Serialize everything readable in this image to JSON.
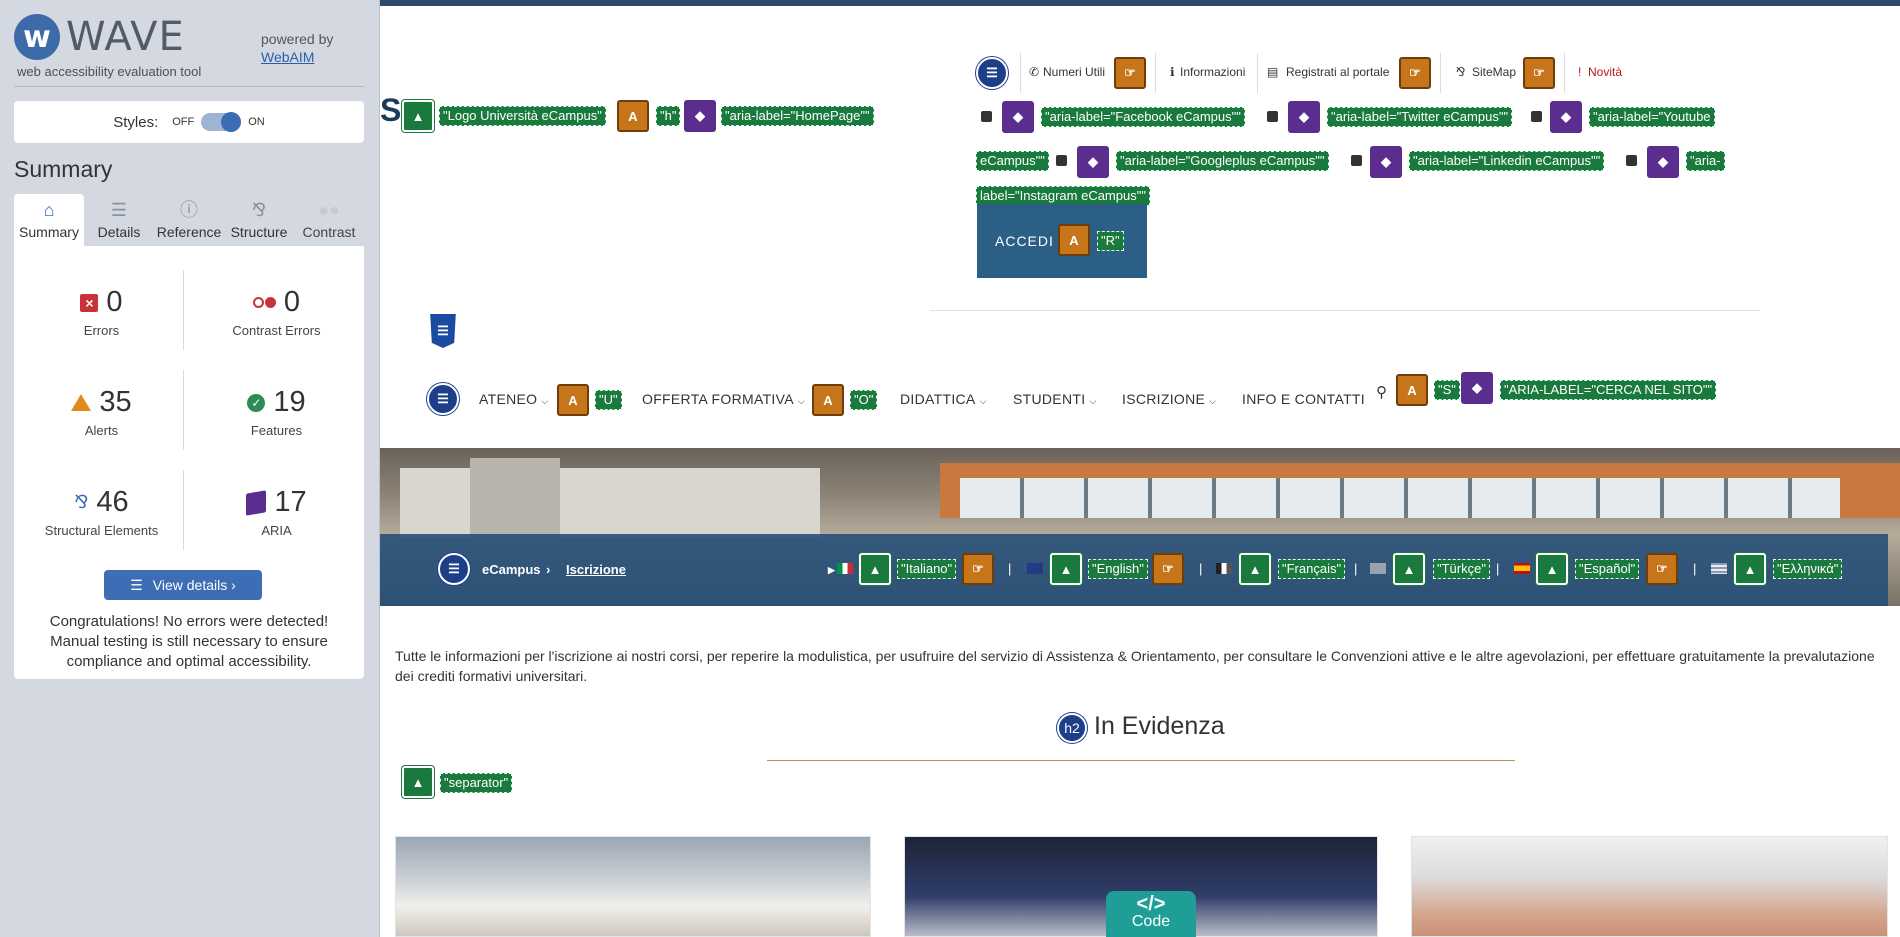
{
  "wave": {
    "logo_text": "WAVE",
    "tagline": "web accessibility evaluation tool",
    "powered_by": "powered by",
    "webaim": "WebAIM",
    "styles_label": "Styles:",
    "off_label": "OFF",
    "on_label": "ON",
    "summary_heading": "Summary",
    "tabs": [
      {
        "label": "Summary",
        "icon": "home-icon"
      },
      {
        "label": "Details",
        "icon": "list-icon"
      },
      {
        "label": "Reference",
        "icon": "info-icon"
      },
      {
        "label": "Structure",
        "icon": "hierarchy-icon"
      },
      {
        "label": "Contrast",
        "icon": "contrast-icon"
      }
    ],
    "stats": {
      "errors": {
        "value": "0",
        "label": "Errors"
      },
      "contrast_errors": {
        "value": "0",
        "label": "Contrast Errors"
      },
      "alerts": {
        "value": "35",
        "label": "Alerts"
      },
      "features": {
        "value": "19",
        "label": "Features"
      },
      "structural": {
        "value": "46",
        "label": "Structural Elements"
      },
      "aria": {
        "value": "17",
        "label": "ARIA"
      }
    },
    "view_details": "View details ›",
    "congrats": "Congratulations! No errors were detected! Manual testing is still necessary to ensure compliance and optimal accessibility."
  },
  "page": {
    "s_letter": "S",
    "header_tags": {
      "logo": "\"Logo Università eCampus\"",
      "h": "\"h\"",
      "homepage": "\"aria-label=\"HomePage\"\""
    },
    "util_links": [
      "Numeri Utili",
      "Informazioni",
      "Registrati al portale",
      "SiteMap",
      "Novità"
    ],
    "social_tags": {
      "facebook": "\"aria-label=\"Facebook eCampus\"\"",
      "twitter": "\"aria-label=\"Twitter eCampus\"\"",
      "youtube_a": "\"aria-label=\"Youtube",
      "youtube_b": "eCampus\"\"",
      "googleplus": "\"aria-label=\"Googleplus eCampus\"\"",
      "linkedin": "\"aria-label=\"Linkedin eCampus\"\"",
      "instagram_a": "\"aria-",
      "instagram_b": "label=\"Instagram eCampus\"\""
    },
    "accedi": "ACCEDI",
    "accedi_tag": "\"R\"",
    "nav": [
      "ATENEO",
      "OFFERTA FORMATIVA",
      "DIDATTICA",
      "STUDENTI",
      "ISCRIZIONE",
      "INFO E CONTATTI"
    ],
    "nav_tags": {
      "u": "\"U\"",
      "o": "\"O\"",
      "s": "\"S\"",
      "search": "\"ARIA-LABEL=\"CERCA NEL SITO\"\""
    },
    "breadcrumb": {
      "home": "eCampus",
      "sep": "›",
      "current": "Iscrizione"
    },
    "languages": [
      "\"Italiano\"",
      "\"English\"",
      "\"Français\"",
      "\"Türkçe\"",
      "\"Español\"",
      "\"Ελληνικά\""
    ],
    "lang_sep": "|",
    "intro": "Tutte le informazioni per l'iscrizione ai nostri corsi, per reperire la modulistica, per usufruire del servizio di Assistenza & Orientamento, per consultare le Convenzioni attive e le altre agevolazioni, per effettuare gratuitamente la prevalutazione dei crediti formativi universitari.",
    "h2_badge": "h2",
    "evidenza": "In Evidenza",
    "separator_tag": "\"separator\"",
    "code_badge": {
      "symbol": "</>",
      "label": "Code"
    }
  },
  "colors": {
    "wave_blue": "#3d6db5",
    "link_green": "#1a7a3d",
    "alert_orange": "#c7751b",
    "aria_purple": "#5b2d8e",
    "breadcrumb_bg": "#224d78"
  }
}
